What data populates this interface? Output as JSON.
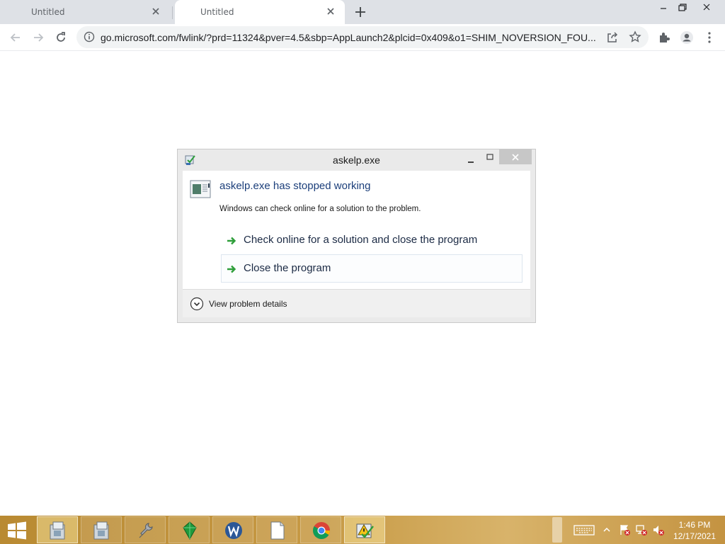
{
  "browser": {
    "tabs": [
      {
        "title": "Untitled",
        "active": false
      },
      {
        "title": "Untitled",
        "active": true
      }
    ],
    "url": "go.microsoft.com/fwlink/?prd=11324&pver=4.5&sbp=AppLaunch2&plcid=0x409&o1=SHIM_NOVERSION_FOU..."
  },
  "dialog": {
    "title": "askelp.exe",
    "heading": "askelp.exe has stopped working",
    "subtext": "Windows can check online for a solution to the problem.",
    "options": [
      {
        "label": "Check online for a solution and close the program",
        "selected": false
      },
      {
        "label": "Close the program",
        "selected": true
      }
    ],
    "details_label": "View problem details"
  },
  "taskbar": {
    "apps": [
      "installer-icon",
      "installer-icon",
      "tools-icon",
      "green-gem-icon",
      "word-icon",
      "document-icon",
      "chrome-icon",
      "warning-shield-icon"
    ],
    "active_app": "installer-icon",
    "clock": {
      "time": "1:46 PM",
      "date": "12/17/2021"
    }
  },
  "colors": {
    "tabstrip": "#dee1e6",
    "dialog_heading": "#1b3e7a",
    "arrow_green": "#2e9e3a",
    "taskbar": "#c79a45"
  }
}
